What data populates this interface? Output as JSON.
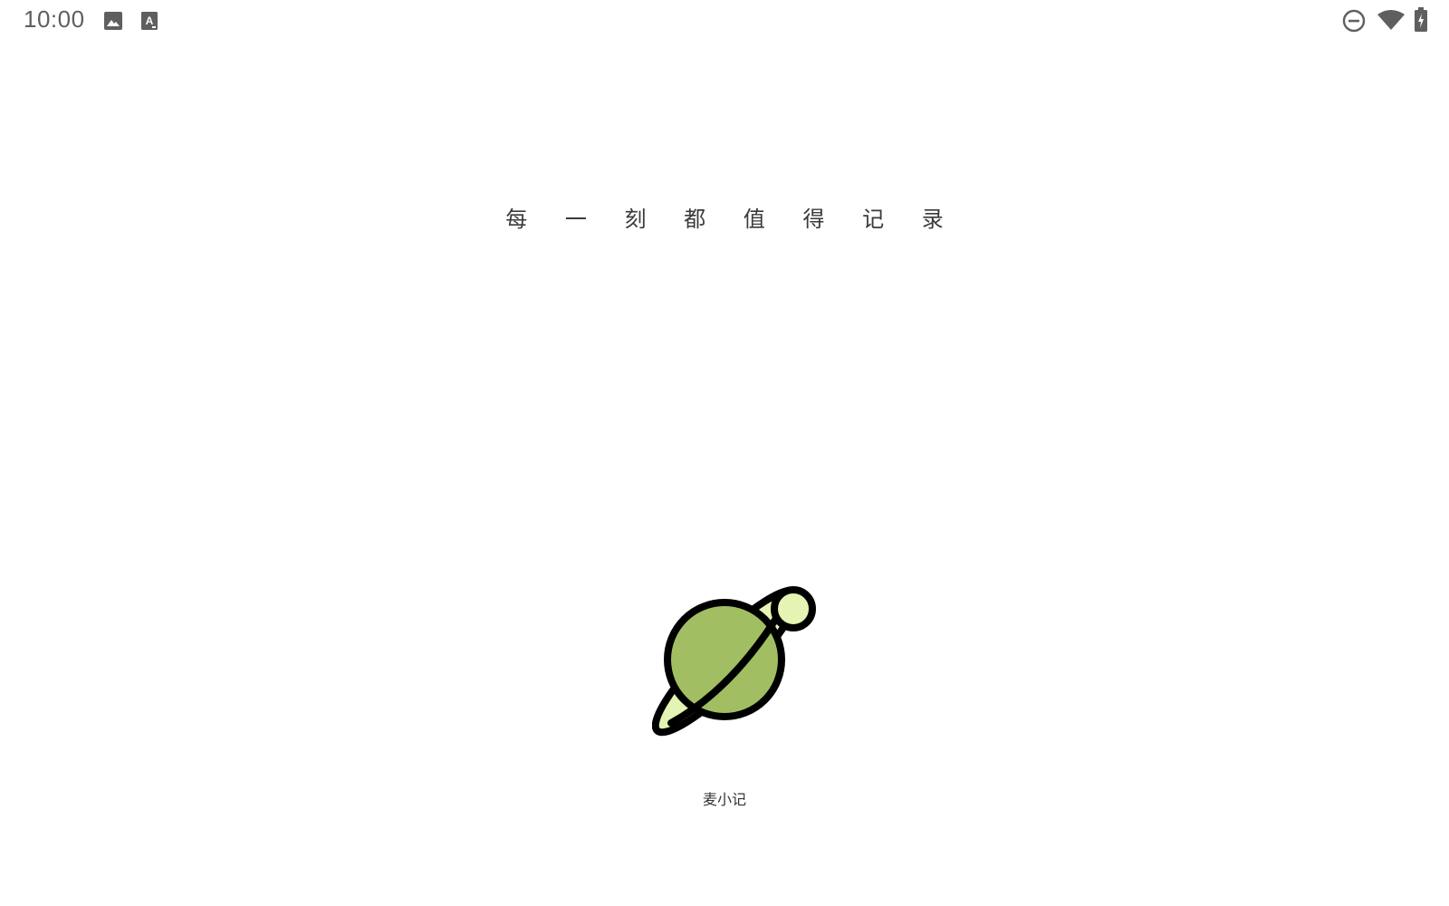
{
  "status_bar": {
    "time": "10:00",
    "left_icons": [
      "image-icon",
      "font-a-icon"
    ],
    "right_icons": [
      "do-not-disturb-icon",
      "wifi-icon",
      "battery-charging-icon"
    ]
  },
  "splash": {
    "tagline": "每 一 刻 都 值 得 记 录",
    "app_name": "麦小记"
  },
  "colors": {
    "planet": "#a1bf62",
    "accent": "#e4f4b3",
    "outline": "#000000",
    "status_icons": "#5f5f5f"
  }
}
